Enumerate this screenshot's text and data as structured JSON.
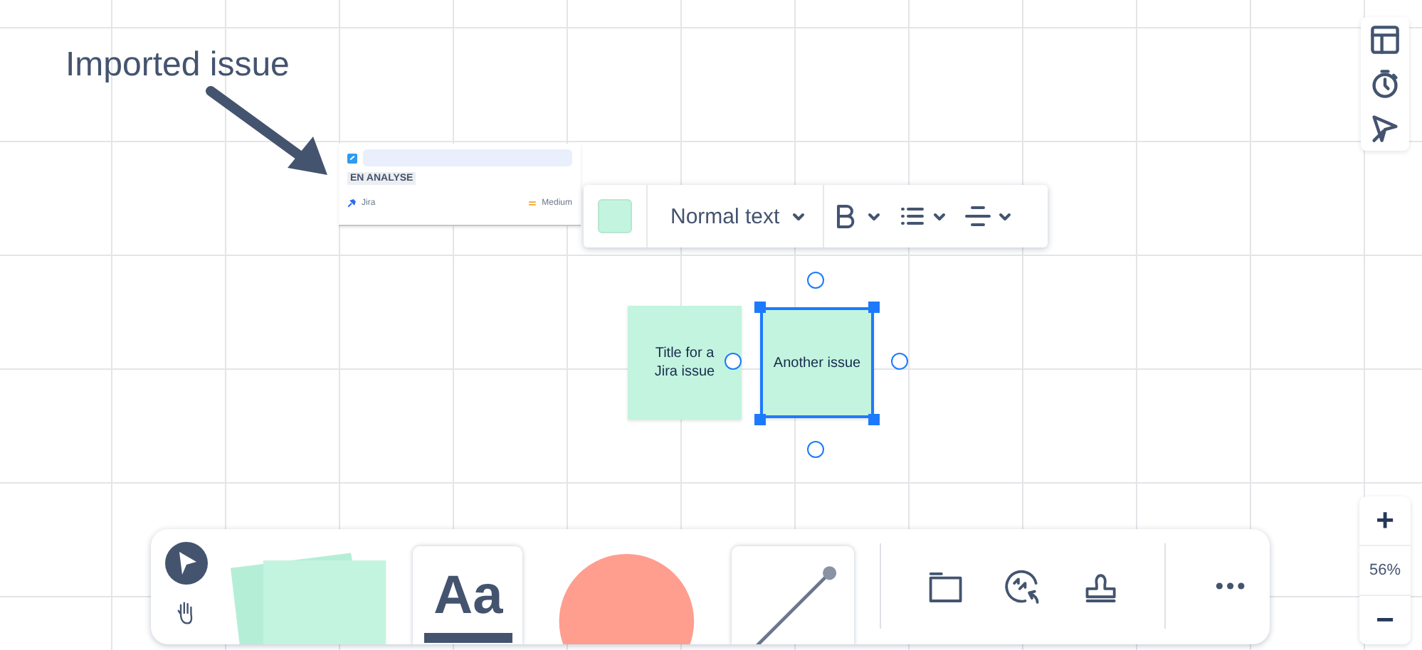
{
  "annotation": {
    "text": "Imported issue"
  },
  "jira_card": {
    "status": "EN ANALYSE",
    "source": "Jira",
    "priority": "Medium"
  },
  "text_tool": {
    "glyph": "Aa"
  },
  "format_toolbar": {
    "color": "#c3f4df",
    "text_style": "Normal text"
  },
  "stickies": [
    {
      "text": "Title for a Jira issue",
      "color": "#c3f4df",
      "selected": false
    },
    {
      "text": "Another issue",
      "color": "#c3f4df",
      "selected": true
    }
  ],
  "tools": [
    {
      "kind": "select",
      "selected": true
    },
    {
      "kind": "hand",
      "selected": false
    }
  ],
  "zoom": {
    "in": "+",
    "level": "56%",
    "out": "−"
  }
}
